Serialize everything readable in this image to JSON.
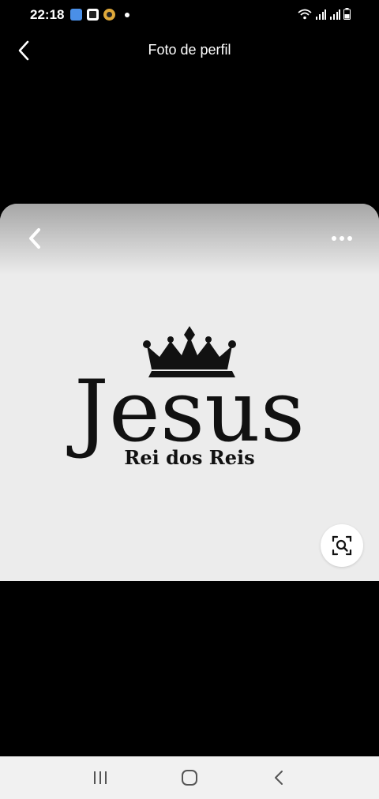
{
  "status_bar": {
    "time": "22:18",
    "notification_icons": [
      "bluesky-icon",
      "gallery-icon",
      "coin-icon"
    ],
    "system_icons": [
      "wifi-icon",
      "signal-icon",
      "signal-icon",
      "battery-icon"
    ]
  },
  "header": {
    "title": "Foto de perfil",
    "back_icon": "chevron-left-icon"
  },
  "photo": {
    "logo_title": "Jesus",
    "logo_subtitle": "Rei dos Reis",
    "back_icon": "chevron-left-icon",
    "more_icon": "more-horizontal-icon",
    "lens_icon": "visual-search-icon"
  },
  "nav_bar": {
    "buttons": [
      "recent-apps-icon",
      "home-icon",
      "back-icon"
    ]
  },
  "colors": {
    "background": "#000000",
    "photo_background": "#ececec",
    "nav_bar": "#f1f1f1"
  }
}
